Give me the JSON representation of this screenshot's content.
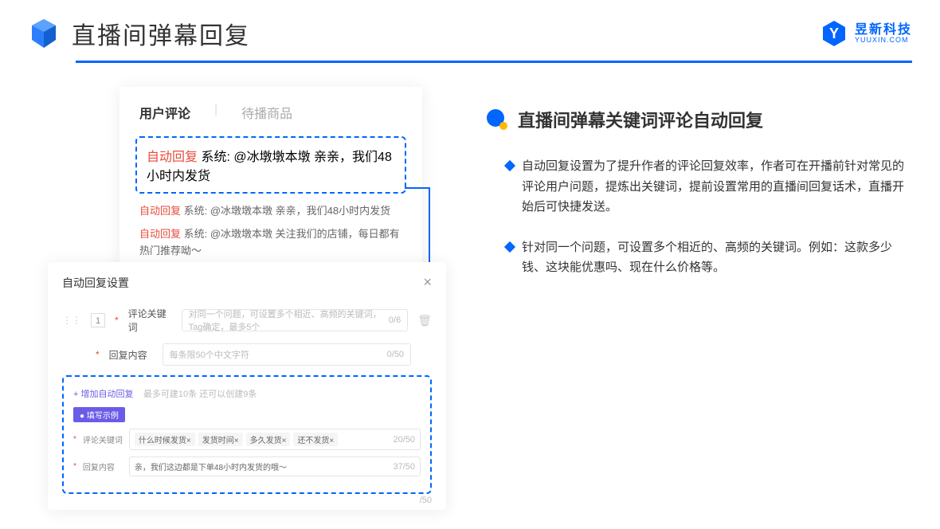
{
  "header": {
    "title": "直播间弹幕回复",
    "brand_name": "昱新科技",
    "brand_sub": "YUUXIN.COM"
  },
  "card1": {
    "tab1": "用户评论",
    "tab2": "待播商品",
    "hl_prefix": "自动回复",
    "hl_text": "系统: @冰墩墩本墩 亲亲，我们48小时内发货",
    "line2_prefix": "自动回复",
    "line2_text": "系统: @冰墩墩本墩 亲亲，我们48小时内发货",
    "line3_prefix": "自动回复",
    "line3_text": "系统: @冰墩墩本墩 关注我们的店铺，每日都有热门推荐呦～"
  },
  "card2": {
    "title": "自动回复设置",
    "num": "1",
    "label1": "评论关键词",
    "placeholder1": "对同一个问题，可设置多个相近、高频的关键词，Tag确定，最多5个",
    "count1": "0/6",
    "label2": "回复内容",
    "placeholder2": "每条限50个中文字符",
    "count2": "0/50",
    "add": "+ 增加自动回复",
    "add_hint": "最多可建10条 还可以创建9条",
    "badge": "● 填写示例",
    "ex_label1": "评论关键词",
    "tag1": "什么时候发货×",
    "tag2": "发货时间×",
    "tag3": "多久发货×",
    "tag4": "还不发货×",
    "ex_count1": "20/50",
    "ex_label2": "回复内容",
    "ex_val2": "亲，我们这边都是下单48小时内发货的哦～",
    "ex_count2": "37/50",
    "outer_count": "/50"
  },
  "right": {
    "title": "直播间弹幕关键词评论自动回复",
    "bullet1": "自动回复设置为了提升作者的评论回复效率，作者可在开播前针对常见的评论用户问题，提炼出关键词，提前设置常用的直播间回复话术，直播开始后可快捷发送。",
    "bullet2": "针对同一个问题，可设置多个相近的、高频的关键词。例如：这款多少钱、这块能优惠吗、现在什么价格等。"
  }
}
